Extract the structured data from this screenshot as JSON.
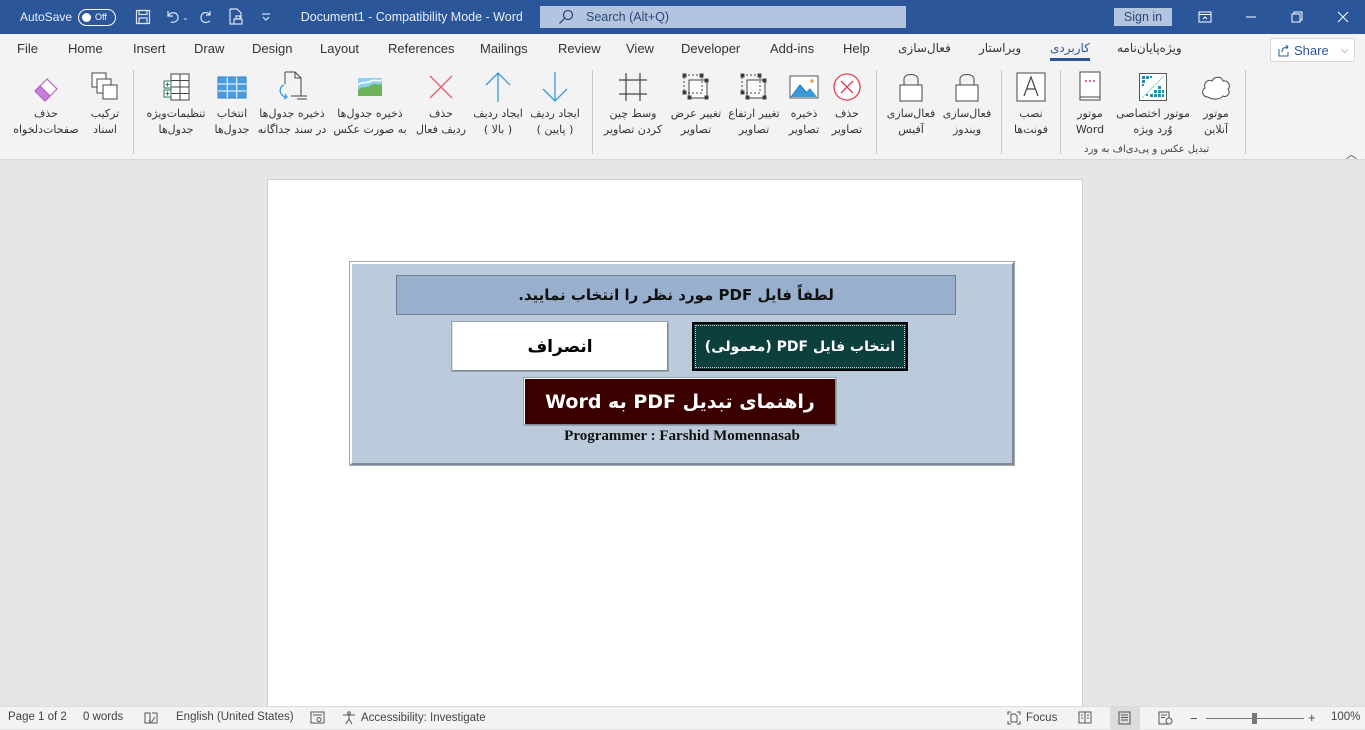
{
  "titlebar": {
    "autosave_label": "AutoSave",
    "autosave_state": "Off",
    "doc_title": "Document1  -  Compatibility Mode  -  Word",
    "search_placeholder": "Search (Alt+Q)",
    "sign_in": "Sign in",
    "icons": [
      "save-icon",
      "undo-icon",
      "undo-dropdown-icon",
      "redo-icon",
      "print-preview-icon",
      "customize-qat-icon",
      "ribbon-display-icon",
      "minimize-icon",
      "restore-icon",
      "close-icon"
    ]
  },
  "menu": {
    "tabs": [
      {
        "label": "File"
      },
      {
        "label": "Home"
      },
      {
        "label": "Insert"
      },
      {
        "label": "Draw"
      },
      {
        "label": "Design"
      },
      {
        "label": "Layout"
      },
      {
        "label": "References"
      },
      {
        "label": "Mailings"
      },
      {
        "label": "Review"
      },
      {
        "label": "View"
      },
      {
        "label": "Developer"
      },
      {
        "label": "Add-ins"
      },
      {
        "label": "Help"
      },
      {
        "label": "فعال‌سازی"
      },
      {
        "label": "ویراستار"
      },
      {
        "label": "کاربردی",
        "active": true
      },
      {
        "label": "ویژه‌پایان‌نامه"
      }
    ],
    "share_label": "Share"
  },
  "ribbon": {
    "buttons": [
      {
        "id": "delete-pages",
        "line1": "حذف",
        "line2": "صفحات‌دلخواه",
        "icon": "eraser-icon"
      },
      {
        "id": "merge-docs",
        "line1": "ترکیب",
        "line2": "اسناد",
        "icon": "copy-stack-icon"
      },
      {
        "id": "table-settings",
        "line1": "تنظیمات‌ویژه",
        "line2": "جدول‌ها",
        "icon": "table-add-icon"
      },
      {
        "id": "select-tables",
        "line1": "انتخاب",
        "line2": "جدول‌ها",
        "icon": "table-grid-icon"
      },
      {
        "id": "save-tables-doc",
        "line1": "ذخیره جدول‌ها",
        "line2": "در سند جداگانه",
        "icon": "save-document-icon"
      },
      {
        "id": "save-tables-image",
        "line1": "ذخیره جدول‌ها",
        "line2": "به صورت عکس",
        "icon": "image-landscape-icon"
      },
      {
        "id": "delete-row",
        "line1": "حذف",
        "line2": "ردیف فعال",
        "icon": "x-mark-icon"
      },
      {
        "id": "insert-row-above",
        "line1": "ایجاد ردیف",
        "line2": "( بالا )",
        "icon": "arrow-up-icon"
      },
      {
        "id": "insert-row-below",
        "line1": "ایجاد ردیف",
        "line2": "( پایین )",
        "icon": "arrow-down-icon"
      },
      {
        "id": "center-images",
        "line1": "وسط چین",
        "line2": "کردن تصاویر",
        "icon": "crop-frame-icon"
      },
      {
        "id": "resize-width",
        "line1": "تغییر عرض",
        "line2": "تصاویر",
        "icon": "resize-width-icon"
      },
      {
        "id": "resize-height",
        "line1": "تغییر ارتفاع",
        "line2": "تصاویر",
        "icon": "resize-height-icon"
      },
      {
        "id": "save-images",
        "line1": "ذخیره",
        "line2": "تصاویر",
        "icon": "picture-icon"
      },
      {
        "id": "delete-images",
        "line1": "حذف",
        "line2": "تصاویر",
        "icon": "circle-x-icon"
      },
      {
        "id": "activate-office",
        "line1": "فعال‌سازی",
        "line2": "آفیس",
        "icon": "lock-icon"
      },
      {
        "id": "activate-windows",
        "line1": "فعال‌سازی",
        "line2": "ویندوز",
        "icon": "lock-icon"
      },
      {
        "id": "install-fonts",
        "line1": "نصب",
        "line2": "فونت‌ها",
        "icon": "font-a-icon"
      },
      {
        "id": "word-engine",
        "line1": "موتور",
        "line2": "Word",
        "icon": "book-icon"
      },
      {
        "id": "custom-engine",
        "line1": "موتور اختصاصی",
        "line2": "وُرد ویژه",
        "icon": "pixel-grid-icon"
      },
      {
        "id": "online-engine",
        "line1": "موتور",
        "line2": "آنلاین",
        "icon": "cloud-icon"
      }
    ],
    "group_label": "تبدیل عکس و پی‌دی‌اف به ورد"
  },
  "form": {
    "header": "لطفاً فایل PDF مورد نظر را انتخاب نمایید.",
    "cancel_label": "انصراف",
    "select_label": "انتخاب فایل PDF (معمولی)",
    "guide_label": "راهنمای تبدیل PDF به Word",
    "programmer": "Programmer : Farshid Momennasab",
    "colors": {
      "panel": "#bccbdb",
      "header": "#98b0cd",
      "select_button": "#0d3f3c",
      "guide_button": "#3a0000"
    }
  },
  "statusbar": {
    "page": "Page 1 of 2",
    "words": "0 words",
    "language": "English (United States)",
    "accessibility": "Accessibility: Investigate",
    "focus": "Focus",
    "zoom": "100%"
  },
  "colors": {
    "brand": "#2b579a"
  }
}
